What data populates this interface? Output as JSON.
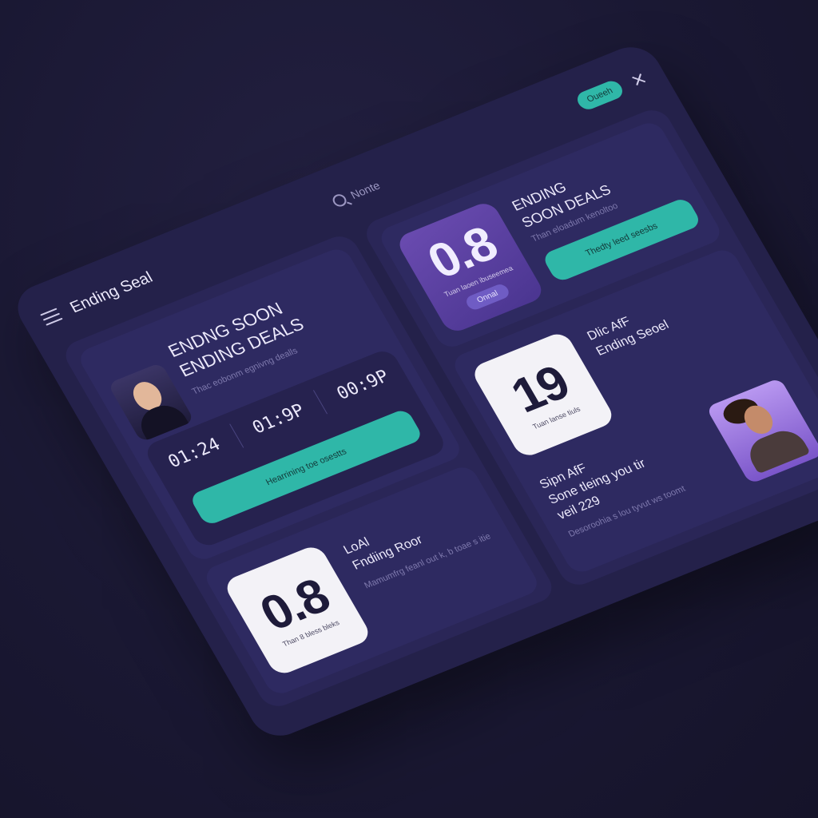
{
  "app": {
    "title": "Ending Seal"
  },
  "search": {
    "label": "Nonte"
  },
  "header": {
    "pill_label": "Oueeh"
  },
  "left": {
    "hero": {
      "title_line1": "ENDNG SOON",
      "title_line2": "ENDING DEALS",
      "subtitle": "Thac eobonm egnivng dealls"
    },
    "timers": [
      "01:24",
      "01:9P",
      "00:9P"
    ],
    "cta_label": "Hearrining toe osestts",
    "card2": {
      "tile_number": "0.8",
      "tile_caption": "Than 8 bless bleks",
      "name_line1": "LoAl",
      "name_line2": "Fndiing Roor",
      "desc": "Mamumfrg feanl out k, b toae s itie"
    }
  },
  "right": {
    "top": {
      "tile_number": "0.8",
      "tile_caption": "Tuan laoen ibuseemea",
      "tile_chip": "Onnal",
      "title_line1": "ENDING",
      "title_line2": "SOON DEALS",
      "desc": "Than eloadum kenoltoo",
      "cta_label": "Thedty leed seesbs"
    },
    "mid": {
      "tile_number": "19",
      "tile_caption": "Tuan lanse tiuls",
      "name_line1": "Dlic AfF",
      "name_line2": "Ending Seoel"
    },
    "bottom": {
      "name_line1": "Sipn AfF",
      "name_line2": "Sone tleing you tir",
      "name_line3": "veil 229",
      "desc": "Desoroohia s lou tyvut ws toomt"
    }
  },
  "colors": {
    "accent": "#2fb7a8",
    "background": "#1a1833",
    "panel": "#2a2657",
    "tile_violet": "#5a3fa0"
  }
}
